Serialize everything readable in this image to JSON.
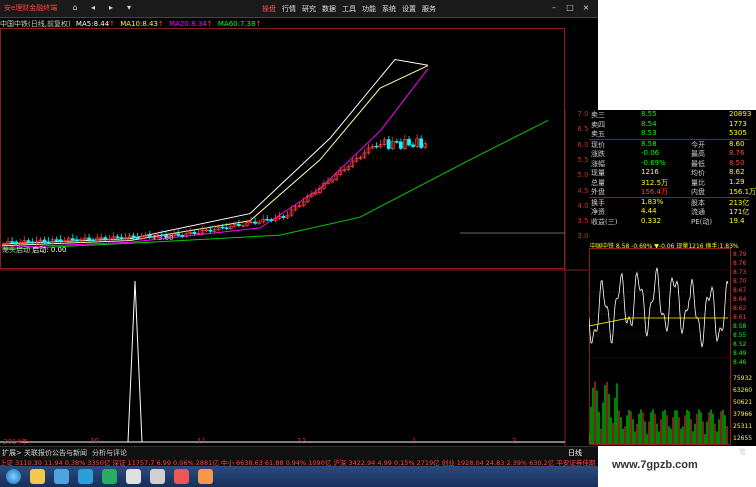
{
  "app": {
    "title": "安e理财金融终端",
    "nav": [
      "⌂",
      "◂",
      "▸",
      "▾"
    ],
    "menu": [
      {
        "label": "操盘",
        "active": true
      },
      {
        "label": "行情",
        "active": false
      },
      {
        "label": "研究",
        "active": false
      },
      {
        "label": "数据",
        "active": false
      },
      {
        "label": "工具",
        "active": false
      },
      {
        "label": "功能",
        "active": false
      },
      {
        "label": "系统",
        "active": false
      },
      {
        "label": "设置",
        "active": false
      },
      {
        "label": "服务",
        "active": false
      }
    ]
  },
  "chart_header": {
    "stock": "中国中铁(日线,前复权)",
    "ma5": {
      "label": "MA5:",
      "value": "8.44",
      "color": "#ffffff"
    },
    "ma10": {
      "label": "MA10:",
      "value": "8.43",
      "color": "#ffff00"
    },
    "ma20": {
      "label": "MA20:",
      "value": "8.34",
      "color": "#ff00ff"
    },
    "ma60": {
      "label": "MA60:",
      "value": "7.38",
      "color": "#00ff00"
    }
  },
  "price_axis": [
    "7.00",
    "6.50",
    "6.00",
    "5.50",
    "5.00",
    "4.50",
    "4.00",
    "3.50",
    "3.00"
  ],
  "low_marker": "↑3.60",
  "indicator": {
    "name": "龙头启动",
    "sub_label": "启动:",
    "value": "0.00"
  },
  "date_axis": [
    "2014年",
    "10",
    "11",
    "12",
    "1",
    "2"
  ],
  "quote": {
    "rows": [
      {
        "l": "卖三",
        "v": "8.55",
        "r": "20893",
        "vc": "#00ff00"
      },
      {
        "l": "卖四",
        "v": "8.54",
        "r": "1773",
        "vc": "#00ff00"
      },
      {
        "l": "卖五",
        "v": "8.53",
        "r": "5305",
        "vc": "#00ff00"
      },
      {
        "l": "现价",
        "v": "8.58",
        "m": "今开",
        "r": "8.60",
        "vc": "#00ff00"
      },
      {
        "l": "涨跌",
        "v": "-0.06",
        "m": "最高",
        "r": "8.76",
        "vc": "#00ff00"
      },
      {
        "l": "涨幅",
        "v": "-0.69%",
        "m": "最低",
        "r": "8.50",
        "vc": "#00ff00"
      },
      {
        "l": "现量",
        "v": "1216",
        "m": "均价",
        "r": "8.62",
        "vc": "#ffff00"
      },
      {
        "l": "总量",
        "v": "312.5万",
        "m": "量比",
        "r": "1.29",
        "vc": "#ffff00"
      },
      {
        "l": "外盘",
        "v": "156.4万",
        "m": "内盘",
        "r": "156.1万",
        "vc": "#ff4040"
      },
      {
        "l": "换手",
        "v": "1.83%",
        "m": "股本",
        "r": "213亿",
        "vc": "#ffff00"
      },
      {
        "l": "净资",
        "v": "4.44",
        "m": "流通",
        "r": "171亿",
        "vc": "#ffff00"
      },
      {
        "l": "收益(三)",
        "v": "0.332",
        "m": "PE(动)",
        "r": "19.4",
        "vc": "#ffff00"
      }
    ]
  },
  "realtime": {
    "header": "中国中铁 8.58 -0.69% ▼-0.06 现量1216 换手:1.83%",
    "price_scale": [
      "8.79",
      "8.76",
      "8.73",
      "8.70",
      "8.67",
      "8.64",
      "8.62",
      "8.61",
      "8.58",
      "8.55",
      "8.52",
      "8.49",
      "8.46"
    ],
    "volume_scale": [
      "75932",
      "63260",
      "50621",
      "37966",
      "25311",
      "12655"
    ],
    "tab": "笔"
  },
  "bottom_tabs": [
    "扩展>",
    "关联报价",
    "公告与新闻",
    "分析与评论"
  ],
  "end_tab": "日线",
  "ticker": "上证 3110.30 11.94 0.38% 3350亿  深证 11757.7 6.99 0.06% 2881亿  中小 6638.63 61.88 0.94% 1090亿  沪深 3422.94 4.99 0.15% 2719亿  创业 1928.04 24.83 2.39% 630.2亿  平安证券佳期",
  "watermark": "www.7gpzb.com",
  "chart_data": [
    {
      "type": "line",
      "title": "中国中铁(日线,前复权)",
      "xlabel": "",
      "ylabel": "",
      "categories": [
        "2014年",
        "10",
        "11",
        "12",
        "1",
        "2"
      ],
      "ylim": [
        3.0,
        9.0
      ],
      "series": [
        {
          "name": "MA5",
          "values": [
            3.6,
            3.7,
            3.85,
            4.5,
            8.44
          ]
        },
        {
          "name": "MA20",
          "values": [
            3.6,
            3.62,
            3.75,
            4.1,
            8.34
          ]
        },
        {
          "name": "MA60",
          "values": [
            3.55,
            3.6,
            3.65,
            3.9,
            7.38
          ]
        }
      ]
    },
    {
      "type": "line",
      "title": "龙头启动",
      "series": [
        {
          "name": "启动",
          "values": [
            0,
            0,
            1,
            0,
            0,
            0,
            0,
            0,
            0,
            0
          ]
        }
      ],
      "ylim": [
        0,
        1
      ]
    }
  ],
  "colors": {
    "up": "#ff4040",
    "down": "#00ff00",
    "accent": "#ffff00",
    "grid": "#8a1f1f"
  }
}
